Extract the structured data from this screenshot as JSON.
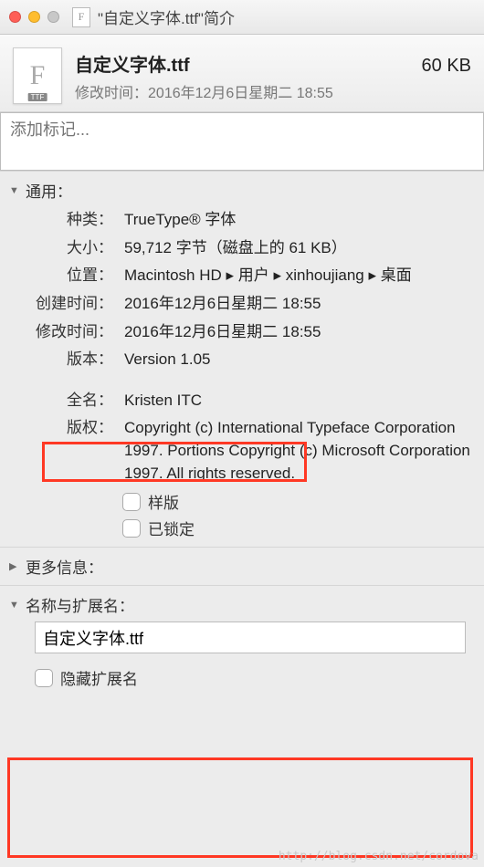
{
  "window": {
    "title": "\"自定义字体.ttf\"简介"
  },
  "header": {
    "filename": "自定义字体.ttf",
    "size": "60 KB",
    "modified_label": "修改时间：",
    "modified_value": "2016年12月6日星期二 18:55",
    "icon_badge": "TTF"
  },
  "tags": {
    "placeholder": "添加标记..."
  },
  "sections": {
    "general": {
      "title": "通用：",
      "fields": {
        "kind_label": "种类：",
        "kind_value": "TrueType® 字体",
        "size_label": "大小：",
        "size_value": "59,712 字节（磁盘上的 61 KB）",
        "where_label": "位置：",
        "where_value": "Macintosh HD ▸ 用户 ▸ xinhoujiang ▸ 桌面",
        "created_label": "创建时间：",
        "created_value": "2016年12月6日星期二 18:55",
        "modified_label": "修改时间：",
        "modified_value": "2016年12月6日星期二 18:55",
        "version_label": "版本：",
        "version_value": "Version 1.05",
        "fullname_label": "全名：",
        "fullname_value": "Kristen ITC",
        "copyright_label": "版权：",
        "copyright_value": "Copyright (c) International Typeface Corporation 1997. Portions Copyright (c) Microsoft Corporation 1997.  All rights reserved.",
        "stationery_label": "样版",
        "locked_label": "已锁定"
      }
    },
    "moreinfo": {
      "title": "更多信息："
    },
    "nameext": {
      "title": "名称与扩展名：",
      "value": "自定义字体.ttf",
      "hide_ext_label": "隐藏扩展名"
    }
  },
  "watermark": "http://blog.csdn.net/cordova"
}
